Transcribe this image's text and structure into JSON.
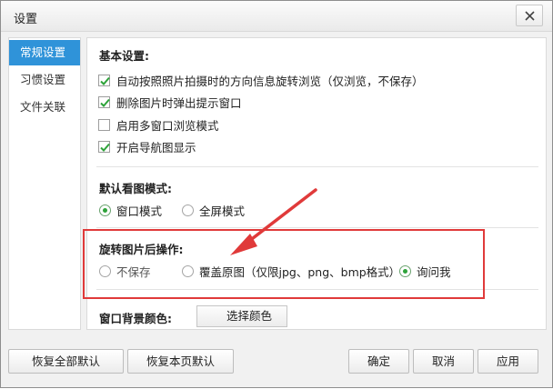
{
  "window": {
    "title": "设置"
  },
  "sidebar": {
    "items": [
      {
        "label": "常规设置",
        "active": true
      },
      {
        "label": "习惯设置",
        "active": false
      },
      {
        "label": "文件关联",
        "active": false
      }
    ]
  },
  "basic": {
    "title": "基本设置:",
    "options": [
      {
        "label": "自动按照照片拍摄时的方向信息旋转浏览（仅浏览，不保存）",
        "checked": true
      },
      {
        "label": "删除图片时弹出提示窗口",
        "checked": true
      },
      {
        "label": "启用多窗口浏览模式",
        "checked": false
      },
      {
        "label": "开启导航图显示",
        "checked": true
      }
    ]
  },
  "view_mode": {
    "title": "默认看图模式:",
    "options": [
      {
        "label": "窗口模式",
        "selected": true
      },
      {
        "label": "全屏模式",
        "selected": false
      }
    ]
  },
  "rotate": {
    "title": "旋转图片后操作:",
    "options": [
      {
        "label": "不保存",
        "selected": false
      },
      {
        "label": "覆盖原图（仅限jpg、png、bmp格式）",
        "selected": false
      },
      {
        "label": "询问我",
        "selected": true
      }
    ]
  },
  "background": {
    "title": "窗口背景颜色:",
    "button_label": "选择颜色"
  },
  "footer": {
    "restore_all": "恢复全部默认",
    "restore_page": "恢复本页默认",
    "ok": "确定",
    "cancel": "取消",
    "apply": "应用"
  },
  "colors": {
    "accent": "#2f93d9",
    "check": "#2ea33a",
    "annotation": "#e03a3a"
  }
}
